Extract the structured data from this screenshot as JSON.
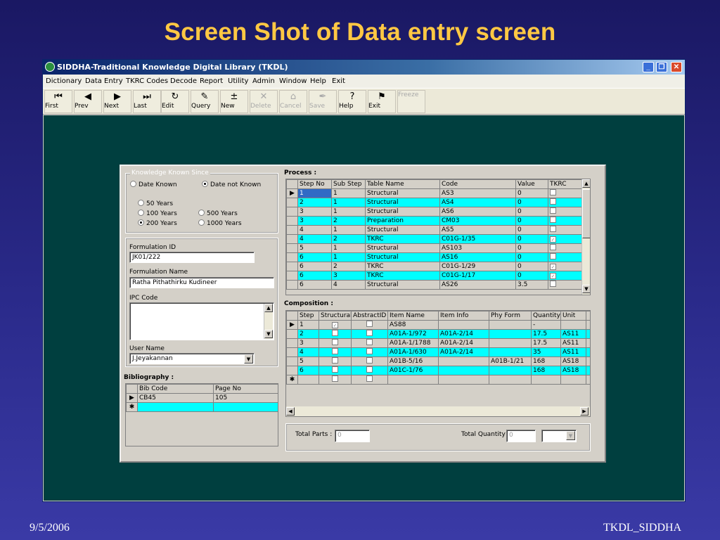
{
  "slide": {
    "title": "Screen Shot of Data entry screen",
    "date": "9/5/2006",
    "footer": "TKDL_SIDDHA"
  },
  "window": {
    "title": "SIDDHA-Traditional Knowledge Digital Library (TKDL)",
    "menu": [
      "Dictionary",
      "Data Entry",
      "TKRC Codes",
      "Decode",
      "Report",
      "Utility",
      "Admin",
      "Window",
      "Help",
      "Exit"
    ],
    "toolbar": [
      {
        "label": "First",
        "icon": "first-record-icon",
        "glyph": "⏮",
        "enabled": true
      },
      {
        "label": "Prev",
        "icon": "prev-record-icon",
        "glyph": "◀",
        "enabled": true
      },
      {
        "label": "Next",
        "icon": "next-record-icon",
        "glyph": "▶",
        "enabled": true
      },
      {
        "label": "Last",
        "icon": "last-record-icon",
        "glyph": "⏭",
        "enabled": true
      },
      {
        "label": "Edit",
        "icon": "edit-icon",
        "glyph": "↻",
        "enabled": true
      },
      {
        "label": "Query",
        "icon": "query-pencil-icon",
        "glyph": "✎",
        "enabled": true
      },
      {
        "label": "New",
        "icon": "new-record-icon",
        "glyph": "±",
        "enabled": true
      },
      {
        "label": "Delete",
        "icon": "delete-icon",
        "glyph": "✕",
        "enabled": false
      },
      {
        "label": "Cancel",
        "icon": "cancel-icon",
        "glyph": "⌂",
        "enabled": false
      },
      {
        "label": "Save",
        "icon": "save-icon",
        "glyph": "✒",
        "enabled": false
      },
      {
        "label": "Help",
        "icon": "help-icon",
        "glyph": "?",
        "enabled": true
      },
      {
        "label": "Exit",
        "icon": "exit-icon",
        "glyph": "⚑",
        "enabled": true
      },
      {
        "label": "Freeze",
        "icon": "freeze-icon",
        "glyph": "",
        "enabled": false
      }
    ]
  },
  "form": {
    "knowledge": {
      "title": "Knowledge Known Since",
      "date_known": "Date Known",
      "date_not_known": "Date not Known",
      "date_selected": "date_not_known",
      "years": [
        "50 Years",
        "100 Years",
        "200 Years",
        "500 Years",
        "1000 Years"
      ],
      "years_selected": "200 Years"
    },
    "formulation_id_label": "Formulation ID",
    "formulation_id": "JK01/222",
    "formulation_name_label": "Formulation Name",
    "formulation_name": "Ratha Pithathirku Kudineer",
    "ipc_code_label": "IPC Code",
    "ipc_code": "",
    "user_name_label": "User  Name",
    "user_name": "J.Jeyakannan",
    "bibliography": {
      "label": "Bibliography :",
      "columns": [
        "Bib Code",
        "Page No"
      ],
      "rows": [
        [
          "CB45",
          "105"
        ]
      ]
    },
    "process": {
      "label": "Process :",
      "columns": [
        "Step No",
        "Sub Step",
        "Table Name",
        "Code",
        "Value",
        "TKRC"
      ],
      "rows": [
        {
          "cells": [
            "1",
            "1",
            "Structural",
            "AS3",
            "0"
          ],
          "tkrc": false,
          "hl": false,
          "current": true
        },
        {
          "cells": [
            "2",
            "1",
            "Structural",
            "AS4",
            "0"
          ],
          "tkrc": false,
          "hl": true
        },
        {
          "cells": [
            "3",
            "1",
            "Structural",
            "AS6",
            "0"
          ],
          "tkrc": false,
          "hl": false
        },
        {
          "cells": [
            "3",
            "2",
            "Preparation",
            "CM03",
            "0"
          ],
          "tkrc": false,
          "hl": true
        },
        {
          "cells": [
            "4",
            "1",
            "Structural",
            "AS5",
            "0"
          ],
          "tkrc": false,
          "hl": false
        },
        {
          "cells": [
            "4",
            "2",
            "TKRC",
            "C01G-1/35",
            "0"
          ],
          "tkrc": true,
          "hl": true
        },
        {
          "cells": [
            "5",
            "1",
            "Structural",
            "AS103",
            "0"
          ],
          "tkrc": false,
          "hl": false
        },
        {
          "cells": [
            "6",
            "1",
            "Structural",
            "AS16",
            "0"
          ],
          "tkrc": false,
          "hl": true
        },
        {
          "cells": [
            "6",
            "2",
            "TKRC",
            "C01G-1/29",
            "0"
          ],
          "tkrc": true,
          "hl": false
        },
        {
          "cells": [
            "6",
            "3",
            "TKRC",
            "C01G-1/17",
            "0"
          ],
          "tkrc": true,
          "hl": true
        },
        {
          "cells": [
            "6",
            "4",
            "Structural",
            "AS26",
            "3.5"
          ],
          "tkrc": false,
          "hl": false
        }
      ]
    },
    "composition": {
      "label": "Composition :",
      "columns": [
        "Step",
        "Structural",
        "AbstractID",
        "Item Name",
        "Item Info",
        "Phy Form",
        "Quantity",
        "Unit"
      ],
      "rows": [
        {
          "step": "1",
          "structural": true,
          "item_name": "AS88",
          "item_info": "",
          "phy_form": "",
          "quantity": "-",
          "unit": "",
          "hl": false,
          "current": true
        },
        {
          "step": "2",
          "structural": false,
          "item_name": "A01A-1/972",
          "item_info": "A01A-2/14",
          "phy_form": "",
          "quantity": "17.5",
          "unit": "AS11",
          "hl": true
        },
        {
          "step": "3",
          "structural": false,
          "item_name": "A01A-1/1788",
          "item_info": "A01A-2/14",
          "phy_form": "",
          "quantity": "17.5",
          "unit": "AS11",
          "hl": false
        },
        {
          "step": "4",
          "structural": false,
          "item_name": "A01A-1/630",
          "item_info": "A01A-2/14",
          "phy_form": "",
          "quantity": "35",
          "unit": "AS11",
          "hl": true
        },
        {
          "step": "5",
          "structural": false,
          "item_name": "A01B-5/16",
          "item_info": "",
          "phy_form": "A01B-1/21",
          "quantity": "168",
          "unit": "AS18",
          "hl": false
        },
        {
          "step": "6",
          "structural": false,
          "item_name": "A01C-1/76",
          "item_info": "",
          "phy_form": "",
          "quantity": "168",
          "unit": "AS18",
          "hl": true
        }
      ]
    },
    "total_parts_label": "Total Parts :",
    "total_parts": "0",
    "total_quantity_label": "Total Quantity :",
    "total_quantity": "0"
  }
}
